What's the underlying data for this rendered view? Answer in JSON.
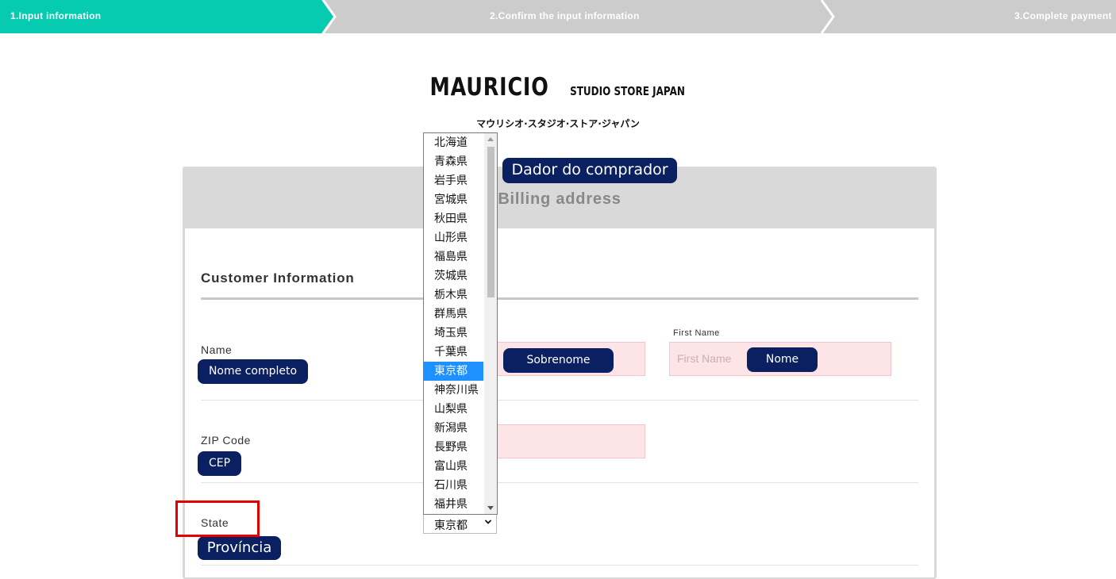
{
  "steps": [
    {
      "label": "1.Input information",
      "active": true
    },
    {
      "label": "2.Confirm the input information",
      "active": false
    },
    {
      "label": "3.Complete payment",
      "active": false
    }
  ],
  "colors": {
    "step_active": "#06cbb0",
    "step_inactive": "#cccccc",
    "pill_navy": "#0b2060",
    "input_pink": "#fde4e6",
    "highlight_red": "#e60000",
    "selected_blue": "#1e90ff"
  },
  "logo": {
    "main": "MAURICIO",
    "sub": "STUDIO STORE JAPAN",
    "kana": "マウリシオ·スタジオ·ストア·ジャパン"
  },
  "panel": {
    "annotation": "Dador do comprador",
    "title": "Billing address"
  },
  "section": {
    "title": "Customer Information"
  },
  "form": {
    "name": {
      "label": "Name",
      "annotation": "Nome completo",
      "last_name_annotation": "Sobrenome",
      "first_name_label": "First Name",
      "first_name_placeholder": "First Name",
      "first_name_annotation": "Nome"
    },
    "zip": {
      "label": "ZIP Code",
      "annotation": "CEP"
    },
    "state": {
      "label": "State",
      "annotation": "Província",
      "selected": "東京都",
      "options": [
        "北海道",
        "青森県",
        "岩手県",
        "宮城県",
        "秋田県",
        "山形県",
        "福島県",
        "茨城県",
        "栃木県",
        "群馬県",
        "埼玉県",
        "千葉県",
        "東京都",
        "神奈川県",
        "山梨県",
        "新潟県",
        "長野県",
        "富山県",
        "石川県",
        "福井県"
      ]
    }
  },
  "icons": {
    "step_arrow": "chevron-right-icon",
    "select_arrow": "chevron-down-icon",
    "scroll_up": "scroll-up-arrow-icon",
    "scroll_down": "scroll-down-arrow-icon"
  }
}
